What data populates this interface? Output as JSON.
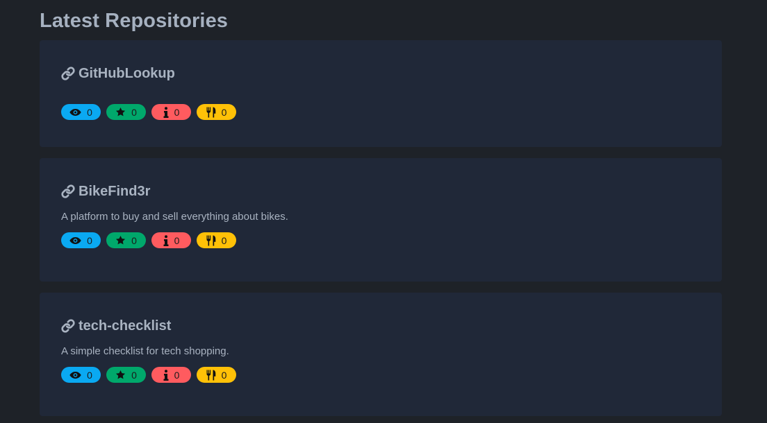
{
  "page": {
    "title": "Latest Repositories"
  },
  "repos": [
    {
      "name": "GitHubLookup",
      "description": "",
      "watchers": "0",
      "stars": "0",
      "issues": "0",
      "forks": "0"
    },
    {
      "name": "BikeFind3r",
      "description": "A platform to buy and sell everything about bikes.",
      "watchers": "0",
      "stars": "0",
      "issues": "0",
      "forks": "0"
    },
    {
      "name": "tech-checklist",
      "description": "A simple checklist for tech shopping.",
      "watchers": "0",
      "stars": "0",
      "issues": "0",
      "forks": "0"
    }
  ],
  "icons": {
    "link": "link-icon",
    "watchers": "eye-icon",
    "stars": "star-icon",
    "issues": "info-icon",
    "forks": "utensils-icon"
  },
  "colors": {
    "background": "#1e2228",
    "card": "#202838",
    "watchers_badge": "#0aa9f2",
    "stars_badge": "#00a86b",
    "issues_badge": "#ff5b5f",
    "forks_badge": "#ffc107"
  }
}
